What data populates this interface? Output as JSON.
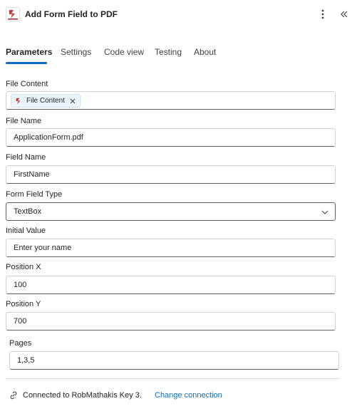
{
  "header": {
    "title": "Add Form Field to PDF",
    "logo_icon": "pdf-app-logo-icon",
    "more_icon": "more-vertical-icon",
    "collapse_icon": "double-chevron-left-icon",
    "accent_color": "#0f6cbd",
    "logo_color": "#d13438"
  },
  "tabs": [
    {
      "label": "Parameters",
      "active": true
    },
    {
      "label": "Settings",
      "active": false
    },
    {
      "label": "Code view",
      "active": false
    },
    {
      "label": "Testing",
      "active": false
    },
    {
      "label": "About",
      "active": false
    }
  ],
  "fields": {
    "file_content": {
      "label": "File Content",
      "chip_label": "File Content",
      "chip_icon": "pdf-app-logo-icon"
    },
    "file_name": {
      "label": "File Name",
      "value": "ApplicationForm.pdf"
    },
    "field_name": {
      "label": "Field Name",
      "value": "FirstName"
    },
    "form_field_type": {
      "label": "Form Field Type",
      "value": "TextBox"
    },
    "initial_value": {
      "label": "Initial Value",
      "value": "Enter your name"
    },
    "position_x": {
      "label": "Position X",
      "value": "100"
    },
    "position_y": {
      "label": "Position Y",
      "value": "700"
    },
    "pages": {
      "label": "Pages",
      "value": "1,3,5"
    }
  },
  "footer": {
    "connected_text": "Connected to RobMathakis Key 3.",
    "change_link": "Change connection",
    "connection_icon": "connection-link-icon"
  }
}
